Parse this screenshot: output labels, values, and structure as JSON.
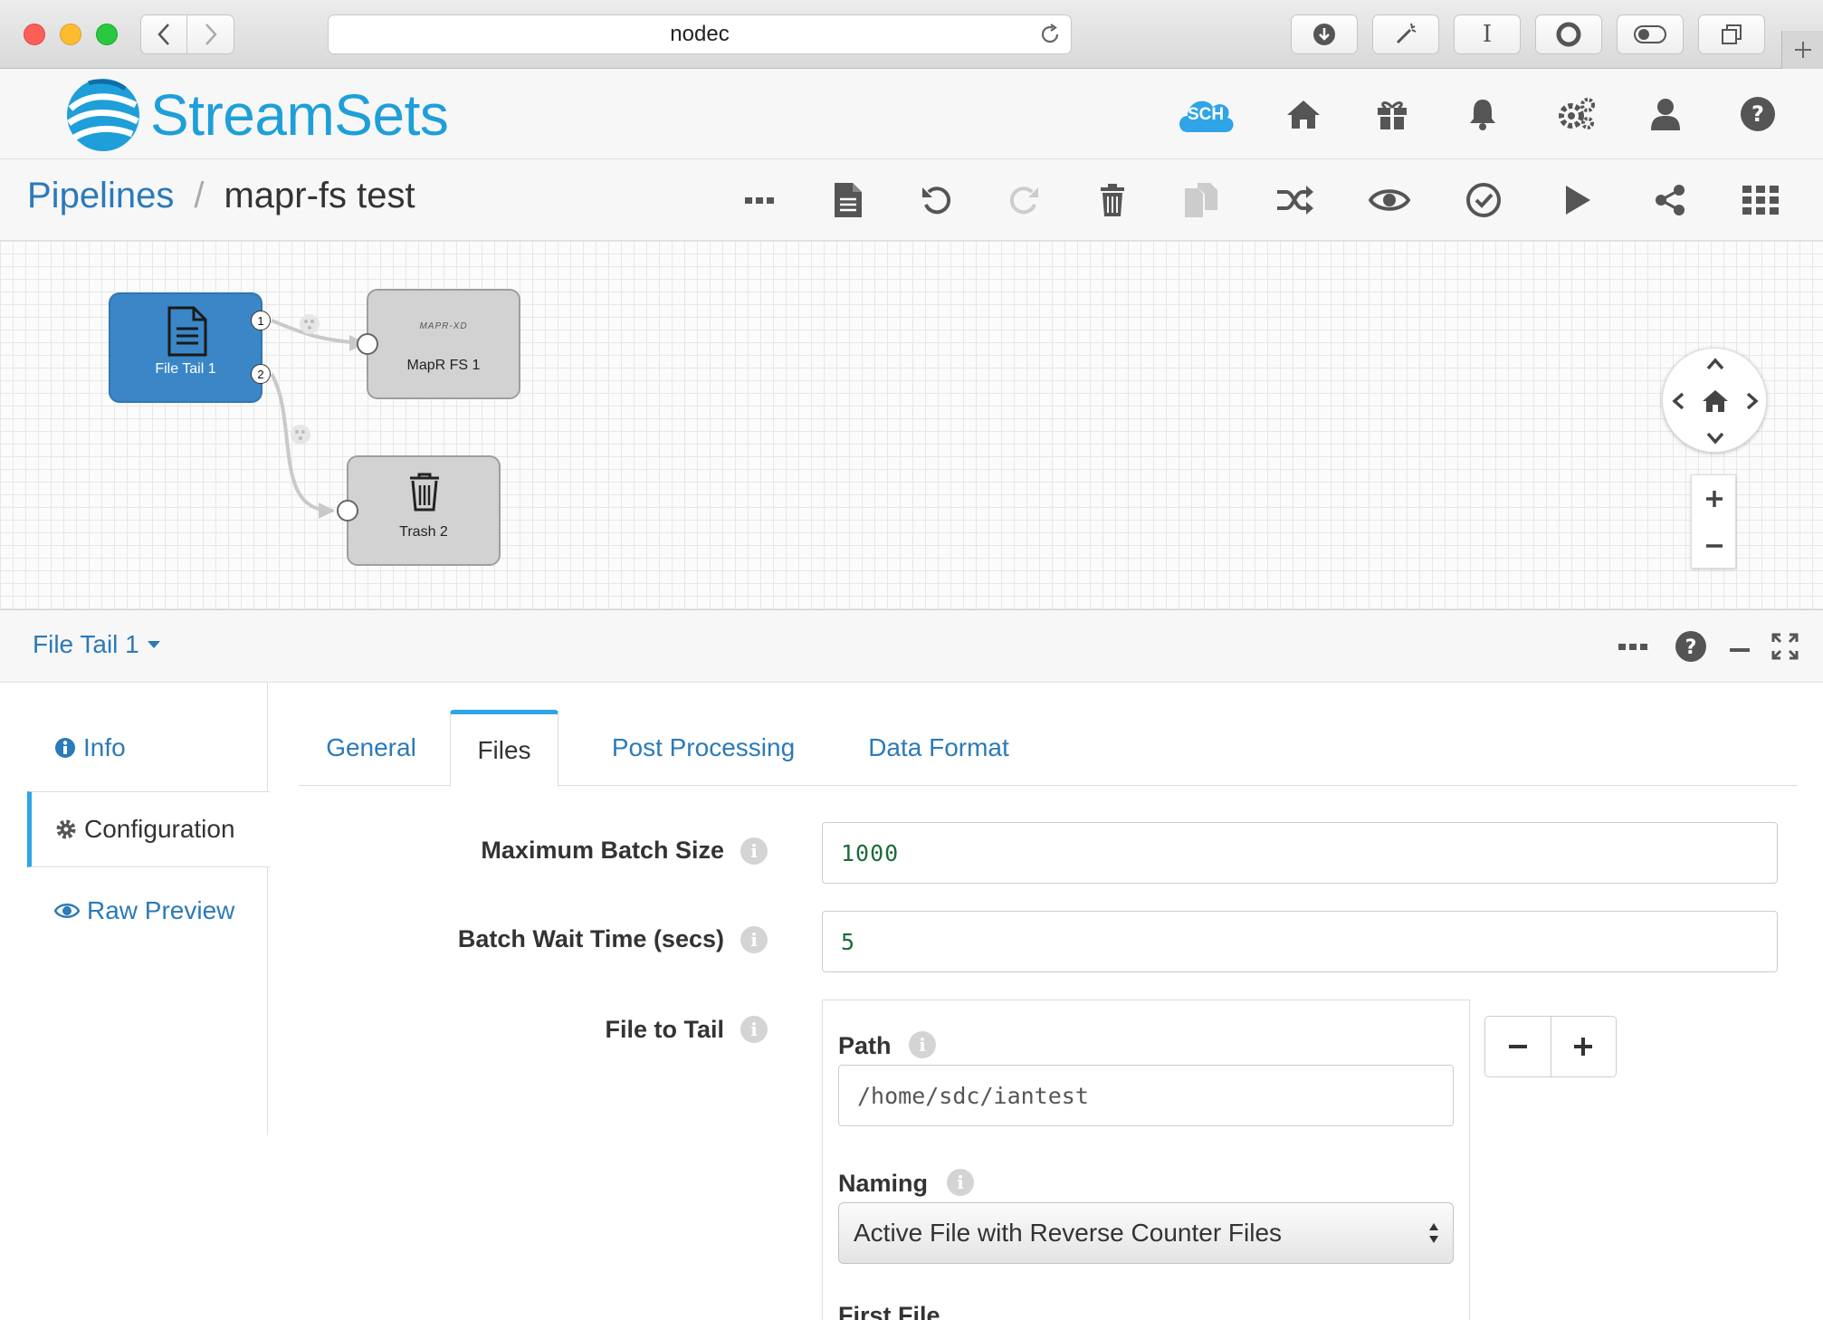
{
  "browser": {
    "url": "nodec",
    "toolbar_text_button": "I"
  },
  "app": {
    "logo_text": "StreamSets",
    "sch_badge": "SCH",
    "header_icons": [
      "home-icon",
      "gift-icon",
      "bell-icon",
      "gears-icon",
      "user-icon",
      "help-icon"
    ]
  },
  "breadcrumb": {
    "root": "Pipelines",
    "separator": "/",
    "current": "mapr-fs test"
  },
  "toolbar_icons": [
    "more-icon",
    "document-icon",
    "undo-icon",
    "redo-icon",
    "delete-icon",
    "duplicate-icon",
    "shuffle-icon",
    "preview-icon",
    "validate-icon",
    "play-icon",
    "share-icon",
    "grid-icon"
  ],
  "canvas": {
    "stages": [
      {
        "label": "File Tail 1",
        "type": "origin",
        "icon": "file-icon",
        "outputs": [
          "1",
          "2"
        ]
      },
      {
        "label": "MapR FS 1",
        "type": "destination",
        "logo": "MAPR-XD"
      },
      {
        "label": "Trash 2",
        "type": "destination",
        "icon": "trash-icon"
      }
    ]
  },
  "detail": {
    "stage_name": "File Tail 1",
    "side_nav": [
      {
        "label": "Info",
        "icon": "info-circle-icon"
      },
      {
        "label": "Configuration",
        "icon": "gear-icon"
      },
      {
        "label": "Raw Preview",
        "icon": "eye-icon"
      }
    ],
    "tabs": [
      "General",
      "Files",
      "Post Processing",
      "Data Format"
    ],
    "active_tab": "Files",
    "fields": {
      "max_batch_size": {
        "label": "Maximum Batch Size",
        "value": "1000"
      },
      "batch_wait_time": {
        "label": "Batch Wait Time (secs)",
        "value": "5"
      },
      "file_to_tail": {
        "label": "File to Tail"
      }
    },
    "file_entry": {
      "path_label": "Path",
      "path_value": "/home/sdc/iantest",
      "naming_label": "Naming",
      "naming_value": "Active File with Reverse Counter Files",
      "next_label": "First File"
    }
  },
  "colors": {
    "brand": "#1e9fd9",
    "link": "#2b7ab9",
    "origin_stage": "#3b86c7",
    "tab_accent": "#2fa4e7"
  }
}
